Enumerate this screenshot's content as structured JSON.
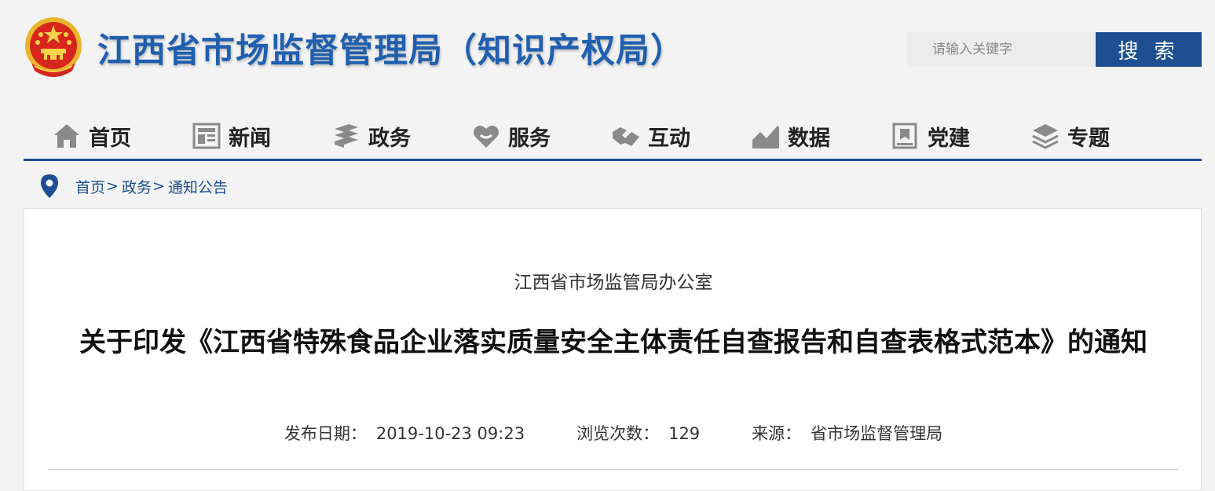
{
  "header": {
    "site_title": "江西省市场监督管理局（知识产权局）",
    "emblem_icon": "national-emblem-icon"
  },
  "search": {
    "placeholder": "请输入关键字",
    "button_label": "搜 索"
  },
  "nav": {
    "items": [
      {
        "label": "首页",
        "icon": "home-icon"
      },
      {
        "label": "新闻",
        "icon": "news-icon"
      },
      {
        "label": "政务",
        "icon": "government-affairs-icon"
      },
      {
        "label": "服务",
        "icon": "service-heart-icon"
      },
      {
        "label": "互动",
        "icon": "handshake-icon"
      },
      {
        "label": "数据",
        "icon": "data-chart-icon"
      },
      {
        "label": "党建",
        "icon": "party-building-icon"
      },
      {
        "label": "专题",
        "icon": "layers-icon"
      }
    ]
  },
  "breadcrumb": {
    "icon": "location-pin-icon",
    "items": [
      "首页",
      "政务",
      "通知公告"
    ],
    "separator": ">"
  },
  "article": {
    "issuer": "江西省市场监管局办公室",
    "title": "关于印发《江西省特殊食品企业落实质量安全主体责任自查报告和自查表格式范本》的通知",
    "meta": {
      "date_label": "发布日期：",
      "date_value": "2019-10-23 09:23",
      "views_label": "浏览次数：",
      "views_value": "129",
      "source_label": "来源：",
      "source_value": "省市场监督管理局"
    }
  },
  "colors": {
    "brand_blue": "#1d4f92",
    "title_blue": "#1f5faf",
    "emblem_red": "#d7261e",
    "emblem_gold": "#f2c230",
    "nav_icon_gray": "#8a8a8a"
  }
}
